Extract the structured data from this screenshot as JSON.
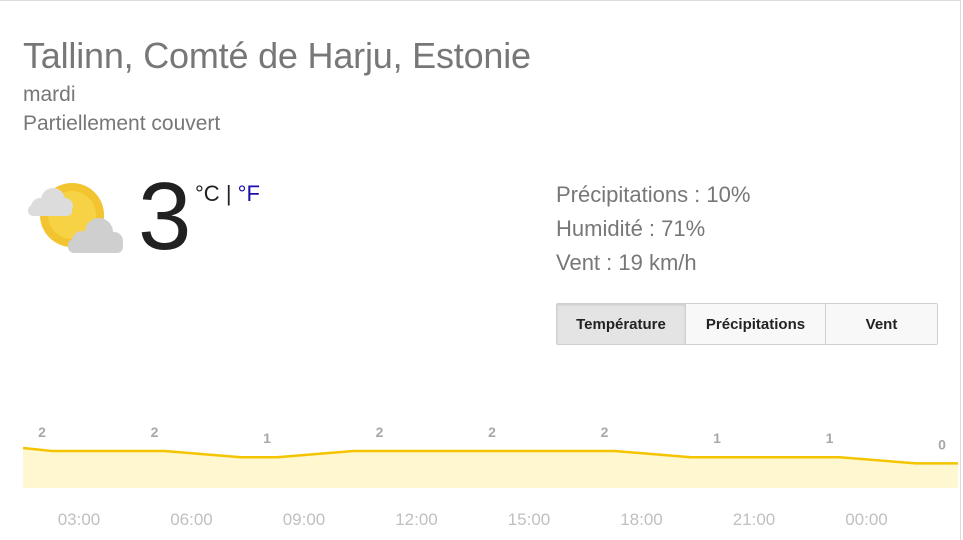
{
  "location": "Tallinn, Comté de Harju, Estonie",
  "day": "mardi",
  "condition": "Partiellement couvert",
  "weather_icon": "partly-cloudy-sun-icon",
  "temperature": "3",
  "units": {
    "celsius": "°C",
    "separator": "|",
    "fahrenheit": "°F"
  },
  "details": {
    "precipitation": "Précipitations : 10%",
    "humidity": "Humidité : 71%",
    "wind": "Vent : 19 km/h"
  },
  "tabs": [
    {
      "label": "Température",
      "active": true
    },
    {
      "label": "Précipitations",
      "active": false
    },
    {
      "label": "Vent",
      "active": false
    }
  ],
  "colors": {
    "line": "#f5c400",
    "fill": "#fff7cf",
    "label": "#a8a8a8",
    "link": "#1a0dab"
  },
  "chart_data": {
    "type": "area",
    "x": [
      "03:00",
      "06:00",
      "09:00",
      "12:00",
      "15:00",
      "18:00",
      "21:00",
      "00:00"
    ],
    "values": [
      2,
      2,
      1,
      2,
      2,
      2,
      1,
      1
    ],
    "end_value": 0,
    "x_tick_labels": [
      "03:00",
      "06:00",
      "09:00",
      "12:00",
      "15:00",
      "18:00",
      "21:00",
      "00:00",
      "0"
    ],
    "grid": false
  }
}
